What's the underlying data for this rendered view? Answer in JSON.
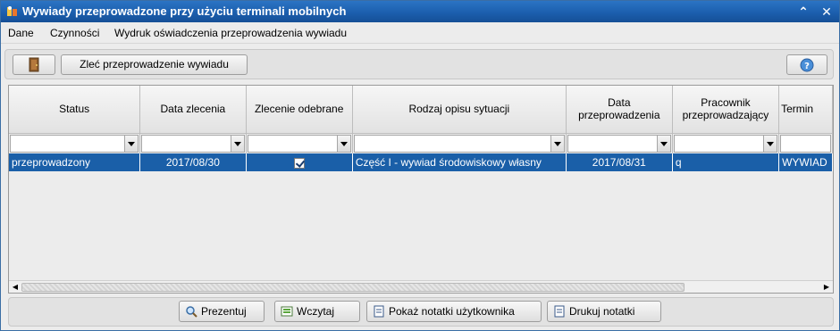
{
  "window": {
    "title": "Wywiady przeprowadzone przy użyciu terminali mobilnych",
    "minimize_glyph": "⌃",
    "close_glyph": "✕"
  },
  "menu": {
    "items": [
      {
        "label": "Dane"
      },
      {
        "label": "Czynności"
      },
      {
        "label": "Wydruk oświadczenia przeprowadzenia wywiadu"
      }
    ]
  },
  "toolbar": {
    "order_label": "Zleć przeprowadzenie wywiadu",
    "exit_icon": "door-exit-icon",
    "help_icon": "help-icon"
  },
  "table": {
    "columns": [
      {
        "label": "Status"
      },
      {
        "label": "Data zlecenia"
      },
      {
        "label": "Zlecenie odebrane"
      },
      {
        "label": "Rodzaj opisu sytuacji"
      },
      {
        "label": "Data przeprowadzenia"
      },
      {
        "label": "Pracownik przeprowadzający"
      },
      {
        "label": "Termin"
      }
    ],
    "rows": [
      {
        "status": "przeprowadzony",
        "data_zlecenia": "2017/08/30",
        "zlecenie_odebrane": true,
        "rodzaj": "Część I - wywiad środowiskowy własny",
        "data_przeprowadzenia": "2017/08/31",
        "pracownik": "q",
        "termin": "WYWIAD"
      }
    ]
  },
  "buttons": {
    "prezentuj": "Prezentuj",
    "wczytaj": "Wczytaj",
    "pokaz_notatki": "Pokaż notatki użytkownika",
    "drukuj_notatki": "Drukuj notatki"
  },
  "colors": {
    "title_bar": "#1c5fae",
    "selection": "#1a5fa8",
    "background": "#ececec"
  }
}
